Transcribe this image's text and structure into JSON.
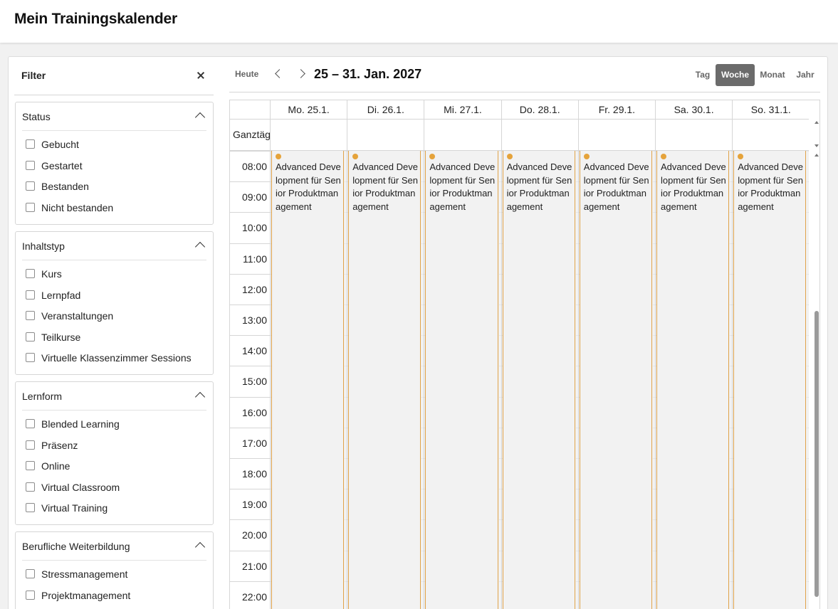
{
  "app": {
    "title": "Mein Trainingskalender"
  },
  "filter": {
    "title": "Filter",
    "close_icon": "close-icon",
    "groups": [
      {
        "title": "Status",
        "options": [
          "Gebucht",
          "Gestartet",
          "Bestanden",
          "Nicht bestanden"
        ]
      },
      {
        "title": "Inhaltstyp",
        "options": [
          "Kurs",
          "Lernpfad",
          "Veranstaltungen",
          "Teilkurse",
          "Virtuelle Klassenzimmer Sessions"
        ]
      },
      {
        "title": "Lernform",
        "options": [
          "Blended Learning",
          "Präsenz",
          "Online",
          "Virtual Classroom",
          "Virtual Training"
        ]
      },
      {
        "title": "Berufliche Weiterbildung",
        "options": [
          "Stressmanagement",
          "Projektmanagement"
        ]
      }
    ]
  },
  "toolbar": {
    "today": "Heute",
    "range": "25 – 31. Jan. 2027",
    "views": [
      "Tag",
      "Woche",
      "Monat",
      "Jahr"
    ],
    "active_view": "Woche"
  },
  "calendar": {
    "allday_label": "Ganztägig",
    "days": [
      "Mo. 25.1.",
      "Di. 26.1.",
      "Mi. 27.1.",
      "Do. 28.1.",
      "Fr. 29.1.",
      "Sa. 30.1.",
      "So. 31.1."
    ],
    "hours": [
      "08:00",
      "09:00",
      "10:00",
      "11:00",
      "12:00",
      "13:00",
      "14:00",
      "15:00",
      "16:00",
      "17:00",
      "18:00",
      "19:00",
      "20:00",
      "21:00",
      "22:00"
    ],
    "event_title": "Advanced Development für Senior Produktmanagement",
    "event_color": "#e5a33b"
  }
}
